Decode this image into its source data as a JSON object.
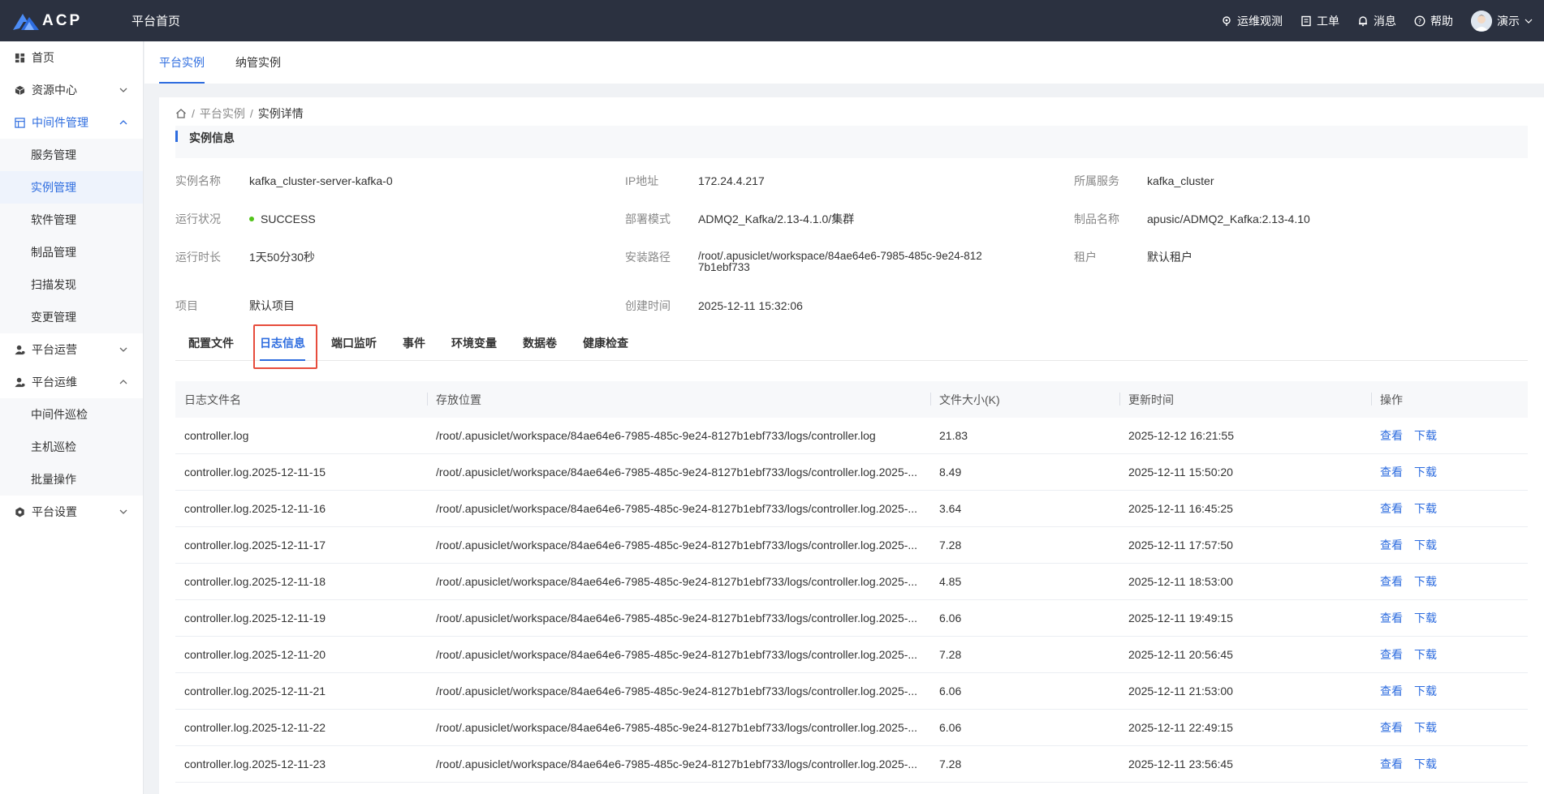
{
  "header": {
    "logo_text": "ACP",
    "home_title": "平台首页",
    "items": [
      {
        "label": "运维观测",
        "icon": "observe-icon"
      },
      {
        "label": "工单",
        "icon": "ticket-icon"
      },
      {
        "label": "消息",
        "icon": "bell-icon"
      },
      {
        "label": "帮助",
        "icon": "help-icon"
      }
    ],
    "user_name": "演示"
  },
  "sidebar": {
    "items": [
      {
        "label": "首页"
      },
      {
        "label": "资源中心"
      },
      {
        "label": "中间件管理"
      },
      {
        "label": "服务管理"
      },
      {
        "label": "实例管理"
      },
      {
        "label": "软件管理"
      },
      {
        "label": "制品管理"
      },
      {
        "label": "扫描发现"
      },
      {
        "label": "变更管理"
      },
      {
        "label": "平台运营"
      },
      {
        "label": "平台运维"
      },
      {
        "label": "中间件巡检"
      },
      {
        "label": "主机巡检"
      },
      {
        "label": "批量操作"
      },
      {
        "label": "平台设置"
      }
    ]
  },
  "tabs": [
    "平台实例",
    "纳管实例"
  ],
  "breadcrumb": {
    "sep": "/",
    "parent": "平台实例",
    "current": "实例详情"
  },
  "section_title": "实例信息",
  "info": {
    "name_label": "实例名称",
    "name": "kafka_cluster-server-kafka-0",
    "ip_label": "IP地址",
    "ip": "172.24.4.217",
    "service_label": "所属服务",
    "service": "kafka_cluster",
    "status_label": "运行状况",
    "status": "SUCCESS",
    "status_color": "#52c41a",
    "mode_label": "部署模式",
    "mode": "ADMQ2_Kafka/2.13-4.1.0/集群",
    "product_label": "制品名称",
    "product": "apusic/ADMQ2_Kafka:2.13-4.10",
    "uptime_label": "运行时长",
    "uptime": "1天50分30秒",
    "path_label": "安装路径",
    "path": "/root/.apusiclet/workspace/84ae64e6-7985-485c-9e24-8127b1ebf733",
    "tenant_label": "租户",
    "tenant": "默认租户",
    "project_label": "项目",
    "project": "默认项目",
    "created_label": "创建时间",
    "created": "2025-12-11 15:32:06"
  },
  "detail_tabs": [
    "配置文件",
    "日志信息",
    "端口监听",
    "事件",
    "环境变量",
    "数据卷",
    "健康检查"
  ],
  "table": {
    "columns": [
      "日志文件名",
      "存放位置",
      "文件大小(K)",
      "更新时间",
      "操作"
    ],
    "actions": {
      "view": "查看",
      "download": "下载"
    },
    "rows": [
      {
        "name": "controller.log",
        "path": "/root/.apusiclet/workspace/84ae64e6-7985-485c-9e24-8127b1ebf733/logs/controller.log",
        "size": "21.83",
        "time": "2025-12-12 16:21:55"
      },
      {
        "name": "controller.log.2025-12-11-15",
        "path": "/root/.apusiclet/workspace/84ae64e6-7985-485c-9e24-8127b1ebf733/logs/controller.log.2025-...",
        "size": "8.49",
        "time": "2025-12-11 15:50:20"
      },
      {
        "name": "controller.log.2025-12-11-16",
        "path": "/root/.apusiclet/workspace/84ae64e6-7985-485c-9e24-8127b1ebf733/logs/controller.log.2025-...",
        "size": "3.64",
        "time": "2025-12-11 16:45:25"
      },
      {
        "name": "controller.log.2025-12-11-17",
        "path": "/root/.apusiclet/workspace/84ae64e6-7985-485c-9e24-8127b1ebf733/logs/controller.log.2025-...",
        "size": "7.28",
        "time": "2025-12-11 17:57:50"
      },
      {
        "name": "controller.log.2025-12-11-18",
        "path": "/root/.apusiclet/workspace/84ae64e6-7985-485c-9e24-8127b1ebf733/logs/controller.log.2025-...",
        "size": "4.85",
        "time": "2025-12-11 18:53:00"
      },
      {
        "name": "controller.log.2025-12-11-19",
        "path": "/root/.apusiclet/workspace/84ae64e6-7985-485c-9e24-8127b1ebf733/logs/controller.log.2025-...",
        "size": "6.06",
        "time": "2025-12-11 19:49:15"
      },
      {
        "name": "controller.log.2025-12-11-20",
        "path": "/root/.apusiclet/workspace/84ae64e6-7985-485c-9e24-8127b1ebf733/logs/controller.log.2025-...",
        "size": "7.28",
        "time": "2025-12-11 20:56:45"
      },
      {
        "name": "controller.log.2025-12-11-21",
        "path": "/root/.apusiclet/workspace/84ae64e6-7985-485c-9e24-8127b1ebf733/logs/controller.log.2025-...",
        "size": "6.06",
        "time": "2025-12-11 21:53:00"
      },
      {
        "name": "controller.log.2025-12-11-22",
        "path": "/root/.apusiclet/workspace/84ae64e6-7985-485c-9e24-8127b1ebf733/logs/controller.log.2025-...",
        "size": "6.06",
        "time": "2025-12-11 22:49:15"
      },
      {
        "name": "controller.log.2025-12-11-23",
        "path": "/root/.apusiclet/workspace/84ae64e6-7985-485c-9e24-8127b1ebf733/logs/controller.log.2025-...",
        "size": "7.28",
        "time": "2025-12-11 23:56:45"
      }
    ]
  },
  "colors": {
    "accent": "#2d6cdf",
    "topbar": "#2b3140",
    "highlight": "#e74c3c"
  }
}
